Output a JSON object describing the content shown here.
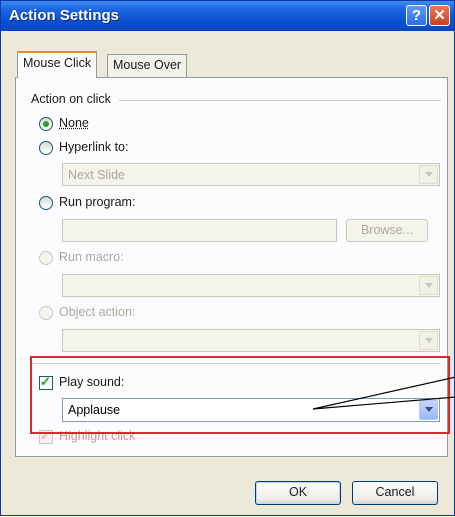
{
  "window": {
    "title": "Action Settings",
    "help_glyph": "?",
    "close_glyph": "✕"
  },
  "tabs": [
    {
      "label": "Mouse Click",
      "selected": true
    },
    {
      "label": "Mouse Over",
      "selected": false
    }
  ],
  "action_group": {
    "label": "Action on click",
    "options": [
      {
        "label": "None",
        "selected": true,
        "enabled": true
      },
      {
        "label": "Hyperlink to:",
        "selected": false,
        "enabled": true
      },
      {
        "label": "Run program:",
        "selected": false,
        "enabled": true
      },
      {
        "label": "Run macro:",
        "selected": false,
        "enabled": false
      },
      {
        "label": "Object action:",
        "selected": false,
        "enabled": false
      }
    ],
    "hyperlink_value": "Next Slide",
    "run_program_value": "",
    "browse_label": "Browse..."
  },
  "sound": {
    "label": "Play sound:",
    "checked": true,
    "value": "Applause"
  },
  "highlight": {
    "label": "Highlight click",
    "checked": true,
    "enabled": false
  },
  "buttons": {
    "ok": "OK",
    "cancel": "Cancel"
  },
  "colors": {
    "title_bar": "#0a4fd0",
    "dialog_bg": "#ece9d8",
    "annotation": "#e0262a",
    "accent_check": "#21a121"
  }
}
